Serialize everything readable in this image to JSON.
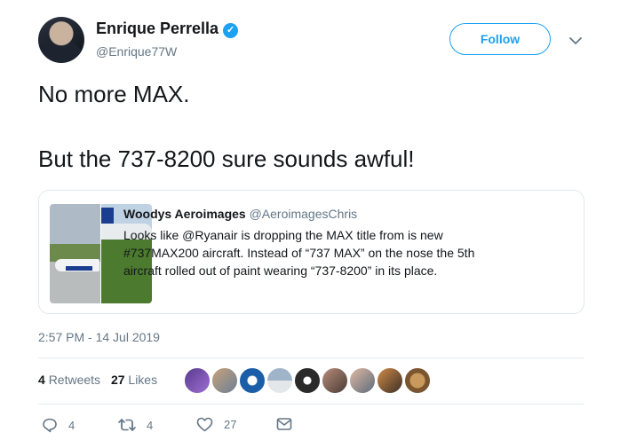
{
  "author": {
    "name": "Enrique Perrella",
    "handle": "@Enrique77W",
    "verified": true
  },
  "header": {
    "follow_label": "Follow",
    "more_icon": "chevron-down-icon"
  },
  "tweet": {
    "line1": "No more MAX.",
    "line2": "But the 737-8200 sure sounds awful!"
  },
  "quote": {
    "name": "Woodys Aeroimages",
    "handle": "@AeroimagesChris",
    "lines": [
      "Looks like @Ryanair is dropping the MAX title from is new",
      "#737MAX200 aircraft. Instead of “737 MAX” on the nose the 5th",
      "aircraft rolled out of paint wearing “737-8200” in its place."
    ]
  },
  "timestamp": "2:57 PM - 14 Jul 2019",
  "stats": {
    "retweets_count": "4",
    "retweets_label": "Retweets",
    "likes_count": "27",
    "likes_label": "Likes"
  },
  "actions": {
    "reply_count": "4",
    "retweet_count": "4",
    "like_count": "27"
  },
  "colors": {
    "accent": "#1da1f2",
    "text": "#14171a",
    "secondary": "#657786",
    "border": "#e1e8ed"
  }
}
